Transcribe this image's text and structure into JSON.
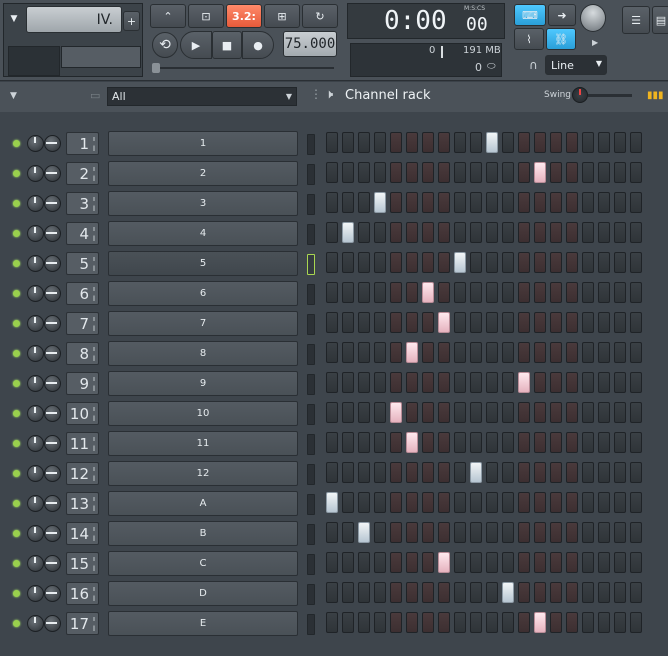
{
  "toolbar": {
    "pattern_label": "IV.",
    "plus_label": "+",
    "tempo": "75.000",
    "time": "0:00",
    "time_small": "00",
    "time_format": "M:S:CS",
    "cpu_value": "0",
    "memory": "191 MB",
    "poly_value": "0",
    "line_mode": "Line",
    "snap_display": "3.2:",
    "accent_color": "#ff6a4a"
  },
  "channel_rack": {
    "filter": "All",
    "title": "Channel rack",
    "swing_label": "Swing"
  },
  "channels": [
    {
      "mixer": "1",
      "name": "1",
      "steps": [
        10
      ]
    },
    {
      "mixer": "2",
      "name": "2",
      "steps": [
        13
      ]
    },
    {
      "mixer": "3",
      "name": "3",
      "steps": [
        3
      ]
    },
    {
      "mixer": "4",
      "name": "4",
      "steps": [
        1
      ]
    },
    {
      "mixer": "5",
      "name": "5",
      "steps": [
        8
      ]
    },
    {
      "mixer": "6",
      "name": "6",
      "steps": [
        6
      ]
    },
    {
      "mixer": "7",
      "name": "7",
      "steps": [
        7
      ]
    },
    {
      "mixer": "8",
      "name": "8",
      "steps": [
        5
      ]
    },
    {
      "mixer": "9",
      "name": "9",
      "steps": [
        12
      ]
    },
    {
      "mixer": "10",
      "name": "10",
      "steps": [
        4
      ]
    },
    {
      "mixer": "11",
      "name": "11",
      "steps": [
        5
      ]
    },
    {
      "mixer": "12",
      "name": "12",
      "steps": [
        9
      ]
    },
    {
      "mixer": "13",
      "name": "A",
      "steps": [
        0
      ]
    },
    {
      "mixer": "14",
      "name": "B",
      "steps": [
        2
      ]
    },
    {
      "mixer": "15",
      "name": "C",
      "steps": [
        7
      ]
    },
    {
      "mixer": "16",
      "name": "D",
      "steps": [
        11
      ]
    },
    {
      "mixer": "17",
      "name": "E",
      "steps": [
        13
      ]
    }
  ],
  "selected_channel": 4,
  "step_count": 20
}
